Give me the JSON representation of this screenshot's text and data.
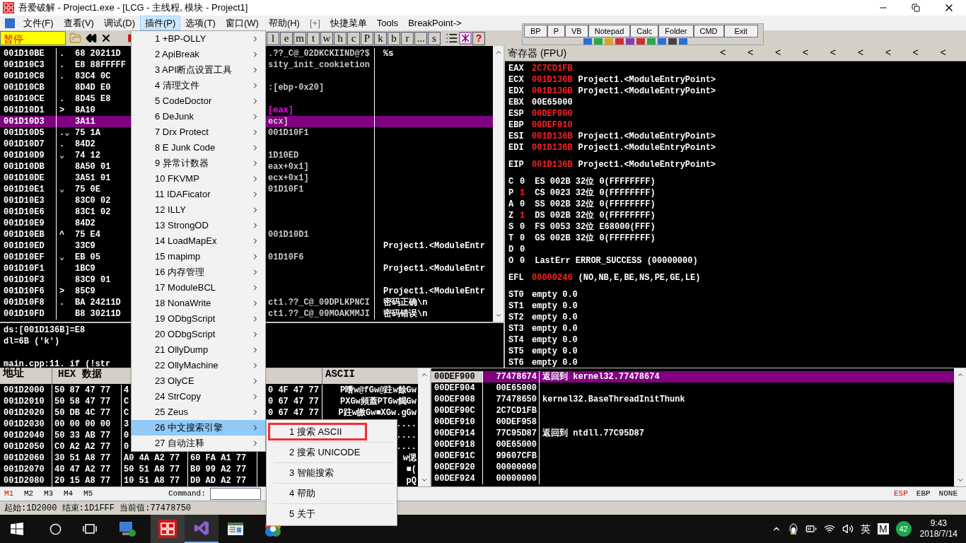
{
  "window": {
    "title": "吾爱破解 - Project1.exe - [LCG - 主线程, 模块 - Project1]"
  },
  "menu_bar": [
    {
      "label": "文件(F)",
      "selected": false
    },
    {
      "label": "查看(V)",
      "selected": false
    },
    {
      "label": "调试(D)",
      "selected": false
    },
    {
      "label": "插件(P)",
      "selected": true
    },
    {
      "label": "选项(T)",
      "selected": false
    },
    {
      "label": "窗口(W)",
      "selected": false
    },
    {
      "label": "帮助(H)",
      "selected": false
    },
    {
      "label": "[+]",
      "selected": false,
      "disabled": true
    },
    {
      "label": "快捷菜单",
      "selected": false
    },
    {
      "label": "Tools",
      "selected": false
    },
    {
      "label": "BreakPoint->",
      "selected": false
    }
  ],
  "toolbar": {
    "status": "暂停",
    "letter_buttons": [
      "l",
      "e",
      "m",
      "t",
      "w",
      "h",
      "c",
      "P",
      "k",
      "b",
      "r",
      "...",
      "s"
    ],
    "help_button": "?"
  },
  "quick_toolbar": {
    "buttons": [
      "BP",
      "P",
      "VB",
      "Notepad",
      "Calc",
      "Folder",
      "CMD",
      "Exit"
    ]
  },
  "disassembly": {
    "rows": [
      {
        "address": "001D10BE",
        "marker": ".",
        "hex": "68 20211D",
        "asm": ".??_C@_02DKCKIIND@?$",
        "comment": "%s",
        "selected": false
      },
      {
        "address": "001D10C3",
        "marker": ".",
        "hex": "E8 88FFFFF",
        "asm": "sity_init_cookietion",
        "selected": false
      },
      {
        "address": "001D10C8",
        "marker": ".",
        "hex": "83C4 0C",
        "selected": false
      },
      {
        "address": "001D10CB",
        "hex": "8D4D E0",
        "asm": ":[ebp-0x20]",
        "selected": false
      },
      {
        "address": "001D10CE",
        "marker": ".",
        "hex": "8D45 E8",
        "selected": false
      },
      {
        "address": "001D10D1",
        "marker": ">",
        "hex": "8A10",
        "asm": "[eax]",
        "color": "#ff00ff",
        "selected": false
      },
      {
        "address": "001D10D3",
        "hex": "3A11",
        "asm": "ecx]",
        "selected": true
      },
      {
        "address": "001D10D5",
        "marker": ".⌄",
        "hex": "75 1A",
        "asm": "001D10F1",
        "selected": false
      },
      {
        "address": "001D10D7",
        "marker": ".",
        "hex": "84D2",
        "selected": false
      },
      {
        "address": "001D10D9",
        "marker": "⌄",
        "hex": "74 12",
        "asm": "1D10ED",
        "selected": false
      },
      {
        "address": "001D10DB",
        "hex": "8A50 01",
        "asm": "eax+0x1]",
        "selected": false
      },
      {
        "address": "001D10DE",
        "hex": "3A51 01",
        "asm": "ecx+0x1]",
        "selected": false
      },
      {
        "address": "001D10E1",
        "marker": "⌄",
        "hex": "75 0E",
        "asm": "01D10F1",
        "selected": false
      },
      {
        "address": "001D10E3",
        "hex": "83C0 02",
        "selected": false
      },
      {
        "address": "001D10E6",
        "hex": "83C1 02",
        "selected": false
      },
      {
        "address": "001D10E9",
        "hex": "84D2",
        "selected": false
      },
      {
        "address": "001D10EB",
        "marker": "^",
        "hex": "75 E4",
        "asm": "001D10D1",
        "selected": false
      },
      {
        "address": "001D10ED",
        "hex": "33C9",
        "comment": "Project1.<ModuleEntr",
        "selected": false
      },
      {
        "address": "001D10EF",
        "marker": "⌄",
        "hex": "EB 05",
        "asm": "01D10F6",
        "selected": false
      },
      {
        "address": "001D10F1",
        "hex": "1BC9",
        "comment": "Project1.<ModuleEntr",
        "selected": false
      },
      {
        "address": "001D10F3",
        "hex": "83C9 01",
        "selected": false
      },
      {
        "address": "001D10F6",
        "marker": ">",
        "hex": "85C9",
        "comment": "Project1.<ModuleEntr",
        "selected": false
      },
      {
        "address": "001D10F8",
        "marker": ".",
        "hex": "BA 24211D",
        "asm": "ct1.??_C@_09DPLKPNCI",
        "comment": "密码正确\\n",
        "selected": false
      },
      {
        "address": "001D10FD",
        "hex": "B8 30211D",
        "asm": "ct1.??_C@_09MOAKMMJI",
        "comment": "密码错误\\n",
        "selected": false
      }
    ],
    "info_lines": [
      "ds:[001D136B]=E8",
      "dl=6B ('k')",
      "main.cpp:11.  if (!str"
    ]
  },
  "registers": {
    "title": "寄存器 (FPU)",
    "arrow_buttons": [
      "<",
      "<",
      "<",
      "<",
      "<",
      "<",
      "<",
      "<",
      "<"
    ],
    "groups": [
      [
        {
          "kind": "register",
          "name": "EAX",
          "value": "2C7CD1FB",
          "changed": true
        },
        {
          "kind": "register",
          "name": "ECX",
          "value": "001D136B",
          "changed": true,
          "rest": "Project1.<ModuleEntryPoint>"
        },
        {
          "kind": "register",
          "name": "EDX",
          "value": "001D136B",
          "changed": true,
          "rest": "Project1.<ModuleEntryPoint>"
        },
        {
          "kind": "register",
          "name": "EBX",
          "value": "00E65000",
          "changed": false
        },
        {
          "kind": "register",
          "name": "ESP",
          "value": "00DEF900",
          "changed": true
        },
        {
          "kind": "register",
          "name": "EBP",
          "value": "00DEF910",
          "changed": true
        },
        {
          "kind": "register",
          "name": "ESI",
          "value": "001D136B",
          "changed": true,
          "rest": "Project1.<ModuleEntryPoint>"
        },
        {
          "kind": "register",
          "name": "EDI",
          "value": "001D136B",
          "changed": true,
          "rest": "Project1.<ModuleEntryPoint>"
        }
      ],
      [
        {
          "kind": "register",
          "name": "EIP",
          "value": "001D136B",
          "changed": true,
          "rest": "Project1.<ModuleEntryPoint>"
        }
      ],
      [
        {
          "kind": "flag",
          "name": "C",
          "value": "0",
          "changed": false,
          "rest": "ES 002B 32位 0(FFFFFFFF)"
        },
        {
          "kind": "flag",
          "name": "P",
          "value": "1",
          "changed": true,
          "rest": "CS 0023 32位 0(FFFFFFFF)"
        },
        {
          "kind": "flag",
          "name": "A",
          "value": "0",
          "changed": false,
          "rest": "SS 002B 32位 0(FFFFFFFF)"
        },
        {
          "kind": "flag",
          "name": "Z",
          "value": "1",
          "changed": true,
          "rest": "DS 002B 32位 0(FFFFFFFF)"
        },
        {
          "kind": "flag",
          "name": "S",
          "value": "0",
          "changed": false,
          "rest": "FS 0053 32位 E68000(FFF)"
        },
        {
          "kind": "flag",
          "name": "T",
          "value": "0",
          "changed": false,
          "rest": "GS 002B 32位 0(FFFFFFFF)"
        },
        {
          "kind": "flag",
          "name": "D",
          "value": "0",
          "changed": false
        },
        {
          "kind": "flag",
          "name": "O",
          "value": "0",
          "changed": false,
          "rest": "LastErr ERROR_SUCCESS (00000000)"
        }
      ],
      [
        {
          "kind": "register",
          "name": "EFL",
          "value": "00000246",
          "changed": true,
          "rest": "(NO,NB,E,BE,NS,PE,GE,LE)"
        }
      ],
      [
        {
          "kind": "register",
          "name": "ST0",
          "value": "empty 0.0",
          "changed": false
        },
        {
          "kind": "register",
          "name": "ST1",
          "value": "empty 0.0",
          "changed": false
        },
        {
          "kind": "register",
          "name": "ST2",
          "value": "empty 0.0",
          "changed": false
        },
        {
          "kind": "register",
          "name": "ST3",
          "value": "empty 0.0",
          "changed": false
        },
        {
          "kind": "register",
          "name": "ST4",
          "value": "empty 0.0",
          "changed": false
        },
        {
          "kind": "register",
          "name": "ST5",
          "value": "empty 0.0",
          "changed": false
        },
        {
          "kind": "register",
          "name": "ST6",
          "value": "empty 0.0",
          "changed": false
        }
      ]
    ]
  },
  "dump": {
    "columns": [
      "地址",
      "HEX 数据",
      "ASCII"
    ],
    "rows": [
      {
        "address": "001D2000",
        "g1": "50 87 47 77",
        "g2": "4",
        "g4": "0 4F 47 77",
        "ascii": "P嗜w@fGw@跓w餘Gw"
      },
      {
        "address": "001D2010",
        "g1": "50 58 47 77",
        "g2": "C",
        "g4": "0 67 47 77",
        "ascii": "PXGw頻蓋PTGw餲Gw"
      },
      {
        "address": "001D2020",
        "g1": "50 DB 4C 77",
        "g2": "C",
        "g4": "0 67 47 77",
        "ascii": "P跓w皦Gw■XGw.gGw"
      },
      {
        "address": "001D2030",
        "g1": "00 00 00 00",
        "g2": "3",
        "ascii": "...."
      },
      {
        "address": "001D2040",
        "g1": "50 33 AB 77",
        "g2": "0",
        "ascii": "...."
      },
      {
        "address": "001D2050",
        "g1": "C0 A2 A2 77",
        "g2": "0",
        "ascii": "...."
      },
      {
        "address": "001D2060",
        "g1": "30 51 A8 77",
        "g2": "A0 4A A2 77",
        "g3": "60 FA A1 77",
        "ascii": "w偲"
      },
      {
        "address": "001D2070",
        "g1": "40 47 A2 77",
        "g2": "50 51 A8 77",
        "g3": "B0 99 A2 77",
        "ascii": "■("
      },
      {
        "address": "001D2080",
        "g1": "20 15 A8 77",
        "g2": "10 51 A8 77",
        "g3": "D0 AD A2 77",
        "ascii": "pQ"
      }
    ]
  },
  "stack": {
    "rows": [
      {
        "address": "00DEF900",
        "value": "77478674",
        "comment": "返回到 kernel32.77478674",
        "selected": true
      },
      {
        "address": "00DEF904",
        "value": "00E65000",
        "selected": false
      },
      {
        "address": "00DEF908",
        "value": "77478650",
        "comment": "kernel32.BaseThreadInitThunk",
        "selected": false
      },
      {
        "address": "00DEF90C",
        "value": "2C7CD1FB",
        "selected": false
      },
      {
        "address": "00DEF910",
        "value": "00DEF958",
        "selected": false
      },
      {
        "address": "00DEF914",
        "value": "77C95D87",
        "comment": "返回到 ntdll.77C95D87",
        "selected": false
      },
      {
        "address": "00DEF918",
        "value": "00E65000",
        "selected": false
      },
      {
        "address": "00DEF91C",
        "value": "99607CFB",
        "selected": false
      },
      {
        "address": "00DEF920",
        "value": "00000000",
        "selected": false
      },
      {
        "address": "00DEF924",
        "value": "00000000",
        "selected": false
      }
    ]
  },
  "command_bar": {
    "dump_tabs": [
      {
        "label": "M1",
        "selected": true
      },
      {
        "label": "M2",
        "selected": false
      },
      {
        "label": "M3",
        "selected": false
      },
      {
        "label": "M4",
        "selected": false
      },
      {
        "label": "M5",
        "selected": false
      }
    ],
    "command_label": "Command:",
    "stack_modes": [
      {
        "label": "ESP",
        "selected": true
      },
      {
        "label": "EBP",
        "selected": false
      },
      {
        "label": "NONE",
        "selected": false
      }
    ]
  },
  "status_bar": "起始:1D2000 结束:1D1FFF 当前值:77478750",
  "plugin_menu": {
    "items": [
      {
        "label": "1 +BP-OLLY",
        "selected": false
      },
      {
        "label": "2 ApiBreak",
        "selected": false
      },
      {
        "label": "3 API断点设置工具",
        "selected": false
      },
      {
        "label": "4 清理文件",
        "selected": false
      },
      {
        "label": "5 CodeDoctor",
        "selected": false
      },
      {
        "label": "6 DeJunk",
        "selected": false
      },
      {
        "label": "7 Drx Protect",
        "selected": false
      },
      {
        "label": "8 E Junk Code",
        "selected": false
      },
      {
        "label": "9 异常计数器",
        "selected": false
      },
      {
        "label": "10 FKVMP",
        "selected": false
      },
      {
        "label": "11 IDAFicator",
        "selected": false
      },
      {
        "label": "12 ILLY",
        "selected": false
      },
      {
        "label": "13 StrongOD",
        "selected": false
      },
      {
        "label": "14 LoadMapEx",
        "selected": false
      },
      {
        "label": "15 mapimp",
        "selected": false
      },
      {
        "label": "16 内存管理",
        "selected": false
      },
      {
        "label": "17 ModuleBCL",
        "selected": false
      },
      {
        "label": "18 NonaWrite",
        "selected": false
      },
      {
        "label": "19 ODbgScript",
        "selected": false
      },
      {
        "label": "20 ODbgScript",
        "selected": false
      },
      {
        "label": "21 OllyDump",
        "selected": false
      },
      {
        "label": "22 OllyMachine",
        "selected": false
      },
      {
        "label": "23 OlyCE",
        "selected": false
      },
      {
        "label": "24 StrCopy",
        "selected": false
      },
      {
        "label": "25 Zeus",
        "selected": false
      },
      {
        "label": "26 中文搜索引擎",
        "selected": true
      },
      {
        "label": "27 自动注释",
        "selected": false
      }
    ]
  },
  "submenu": {
    "items": [
      {
        "label": "1 搜索 ASCII",
        "highlighted": true
      },
      {
        "label": "2 搜索 UNICODE",
        "highlighted": false
      },
      {
        "label": "3 智能搜索",
        "highlighted": false
      },
      {
        "label": "4 帮助",
        "highlighted": false
      },
      {
        "label": "5 关于",
        "highlighted": false
      }
    ]
  },
  "taskbar": {
    "input_indicator": "英",
    "ime": "M",
    "notification_count": "42",
    "time": "9:43",
    "date": "2018/7/14"
  }
}
